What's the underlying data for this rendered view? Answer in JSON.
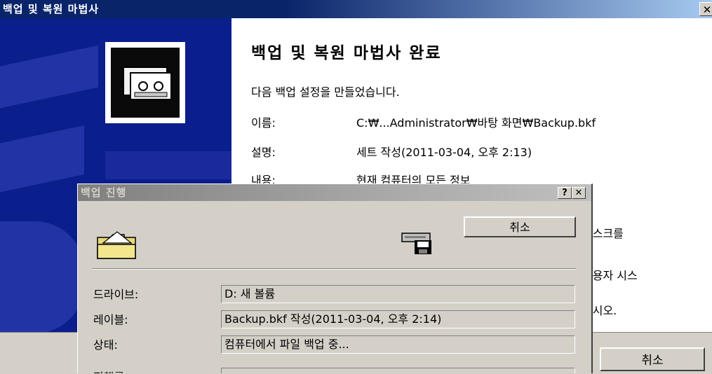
{
  "wizard": {
    "title": "백업 및 복원 마법사",
    "close_glyph": "✕",
    "heading": "백업 및 복원 마법사 완료",
    "intro": "다음 백업 설정을 만들었습니다.",
    "settings": [
      {
        "label": "이름:",
        "value": "C:₩...Administrator₩바탕 화면₩Backup.bkf"
      },
      {
        "label": "설명:",
        "value": "세트 작성(2011-03-04, 오후 2:13)"
      },
      {
        "label": "내용:",
        "value": "현재 컴퓨터의 모든 정보"
      }
    ],
    "partial_lines": [
      "디스크를",
      "사용자 시스",
      "십시오."
    ],
    "cancel_label": "취소",
    "accent_color": "#0a246a",
    "side_color": "#0a1e8c"
  },
  "progress": {
    "title": "백업 진행",
    "help_glyph": "?",
    "close_glyph": "✕",
    "cancel_label": "취소",
    "fields": [
      {
        "label": "드라이브:",
        "value": "D: 새 볼륨"
      },
      {
        "label": "레이블:",
        "value": "Backup.bkf 작성(2011-03-04, 오후 2:14)"
      },
      {
        "label": "상태:",
        "value": "컴퓨터에서 파일 백업 중..."
      }
    ],
    "partial_label": "진행률"
  }
}
